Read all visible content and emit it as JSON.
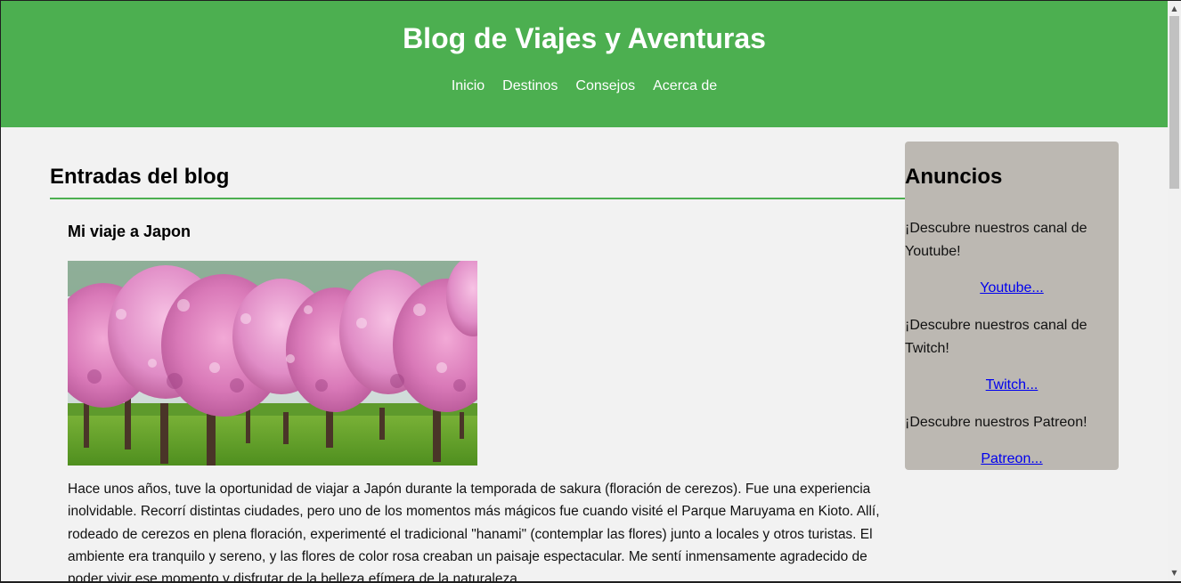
{
  "header": {
    "title": "Blog de Viajes y Aventuras",
    "nav": [
      "Inicio",
      "Destinos",
      "Consejos",
      "Acerca de"
    ],
    "background_color": "#4caf50"
  },
  "main": {
    "heading": "Entradas del blog",
    "post": {
      "title": "Mi viaje a Japon",
      "image": "cherry-blossom-park-photo",
      "text": "Hace unos años, tuve la oportunidad de viajar a Japón durante la temporada de sakura (floración de cerezos). Fue una experiencia inolvidable. Recorrí distintas ciudades, pero uno de los momentos más mágicos fue cuando visité el Parque Maruyama en Kioto. Allí, rodeado de cerezos en plena floración, experimenté el tradicional \"hanami\" (contemplar las flores) junto a locales y otros turistas. El ambiente era tranquilo y sereno, y las flores de color rosa creaban un paisaje espectacular. Me sentí inmensamente agradecido de poder vivir ese momento y disfrutar de la belleza efímera de la naturaleza."
    }
  },
  "sidebar": {
    "heading": "Anuncios",
    "ads": [
      {
        "text": "¡Descubre nuestros canal de Youtube!",
        "link": "Youtube..."
      },
      {
        "text": "¡Descubre nuestros canal de Twitch!",
        "link": "Twitch..."
      },
      {
        "text": "¡Descubre nuestros Patreon!",
        "link": "Patreon..."
      }
    ],
    "background_color": "#bcb8b2"
  },
  "colors": {
    "accent": "#4caf50",
    "link": "#0000ee",
    "page_background": "#f2f2f2"
  }
}
